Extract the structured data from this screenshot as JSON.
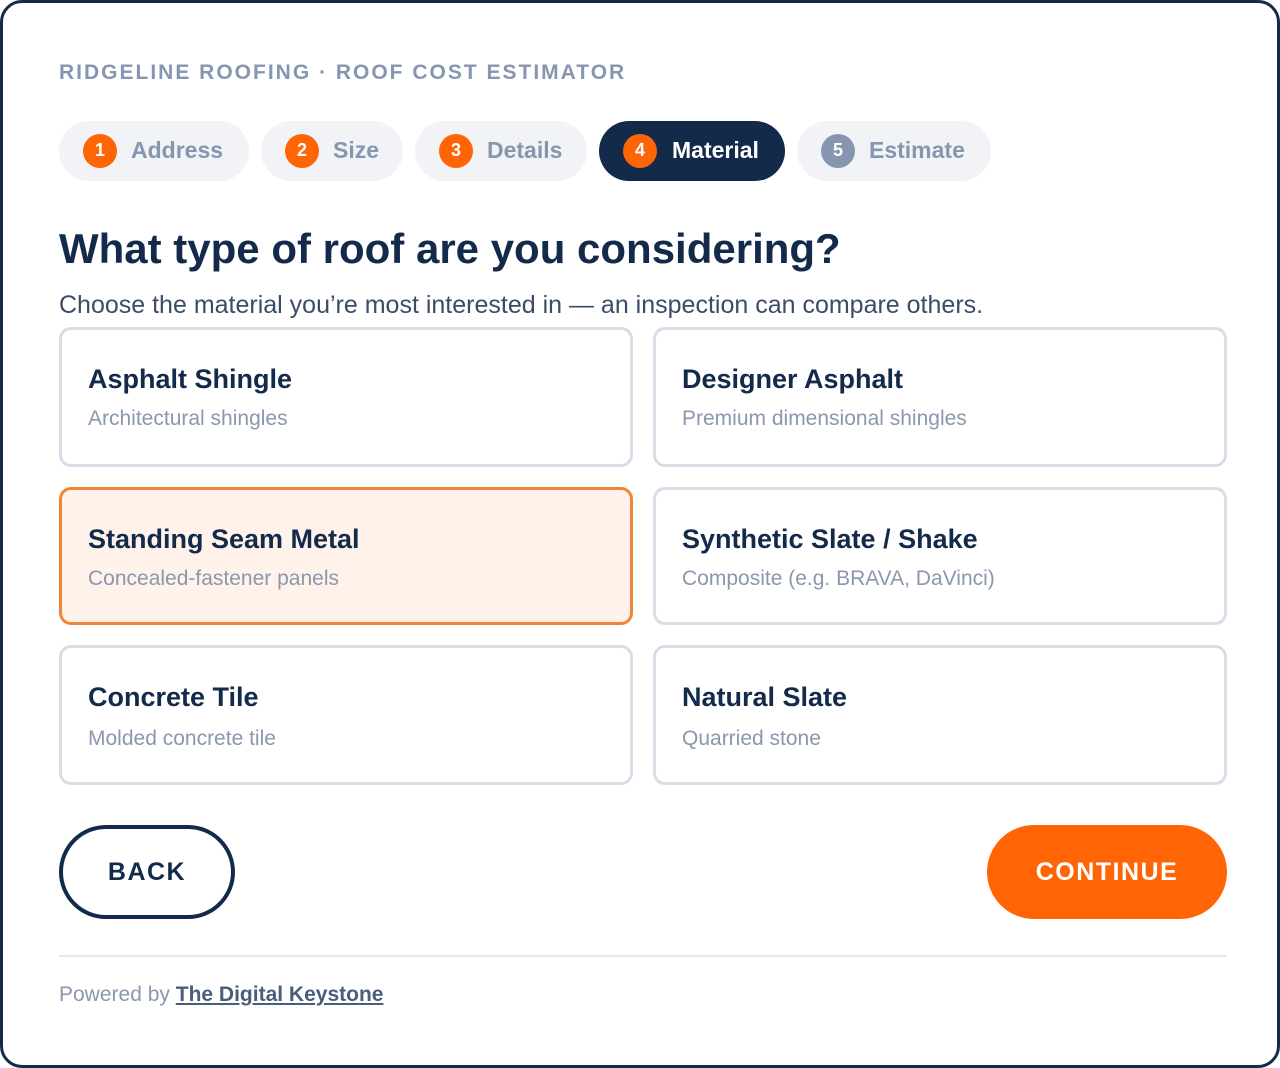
{
  "header": {
    "brand": "RIDGELINE ROOFING · ROOF COST ESTIMATOR"
  },
  "steps": [
    {
      "num": "1",
      "label": "Address",
      "state": "completed"
    },
    {
      "num": "2",
      "label": "Size",
      "state": "completed"
    },
    {
      "num": "3",
      "label": "Details",
      "state": "completed"
    },
    {
      "num": "4",
      "label": "Material",
      "state": "active"
    },
    {
      "num": "5",
      "label": "Estimate",
      "state": "upcoming"
    }
  ],
  "question": {
    "title": "What type of roof are you considering?",
    "subtitle": "Choose the material you’re most interested in — an inspection can compare others."
  },
  "options": [
    {
      "title": "Asphalt Shingle",
      "desc": "Architectural shingles",
      "selected": false
    },
    {
      "title": "Designer Asphalt",
      "desc": "Premium dimensional shingles",
      "selected": false
    },
    {
      "title": "Standing Seam Metal",
      "desc": "Concealed-fastener panels",
      "selected": true
    },
    {
      "title": "Synthetic Slate / Shake",
      "desc": "Composite (e.g. BRAVA, DaVinci)",
      "selected": false
    },
    {
      "title": "Concrete Tile",
      "desc": "Molded concrete tile",
      "selected": false
    },
    {
      "title": "Natural Slate",
      "desc": "Quarried stone",
      "selected": false
    }
  ],
  "actions": {
    "back_label": "BACK",
    "continue_label": "CONTINUE"
  },
  "footer": {
    "prefix": "Powered by",
    "link_text": "The Digital Keystone"
  },
  "colors": {
    "accent": "#ff6405",
    "navy": "#132a4a",
    "muted": "#8796b0",
    "selected_border": "#f08538",
    "selected_bg": "#fff2ea"
  }
}
